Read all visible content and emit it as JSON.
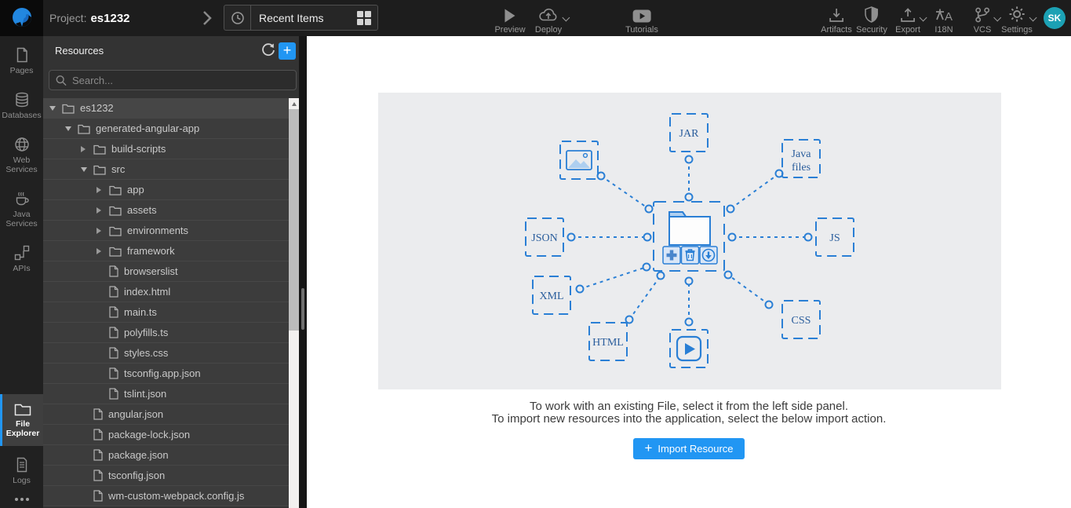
{
  "topbar": {
    "project_label": "Project:",
    "project_name": "es1232",
    "recent": {
      "label": "Recent Items"
    },
    "center_actions": [
      {
        "label": "Preview",
        "icon": "play-icon",
        "caret": false
      },
      {
        "label": "Deploy",
        "icon": "cloud-upload-icon",
        "caret": true
      },
      {
        "label": "Tutorials",
        "icon": "video-tutorials-icon",
        "caret": false
      }
    ],
    "right_actions": [
      {
        "label": "Artifacts",
        "icon": "download-tray-icon",
        "caret": false
      },
      {
        "label": "Security",
        "icon": "shield-icon",
        "caret": false
      },
      {
        "label": "Export",
        "icon": "upload-tray-icon",
        "caret": true
      },
      {
        "label": "I18N",
        "icon": "translate-icon",
        "caret": false
      },
      {
        "label": "VCS",
        "icon": "git-branch-icon",
        "caret": true
      },
      {
        "label": "Settings",
        "icon": "gear-icon",
        "caret": true
      }
    ],
    "avatar_initials": "SK"
  },
  "sidebar": {
    "items": [
      {
        "label": "Pages",
        "icon": "page-icon"
      },
      {
        "label": "Databases",
        "icon": "database-icon"
      },
      {
        "label": "Web Services",
        "icon": "globe-icon"
      },
      {
        "label": "Java Services",
        "icon": "coffee-cup-icon"
      },
      {
        "label": "APIs",
        "icon": "api-nodes-icon"
      },
      {
        "label": "File Explorer",
        "icon": "folder-icon",
        "active": true
      },
      {
        "label": "Logs",
        "icon": "log-file-icon"
      }
    ]
  },
  "resources": {
    "title": "Resources",
    "search_placeholder": "Search...",
    "tree": [
      {
        "name": "es1232",
        "type": "folder",
        "level": 0,
        "state": "expanded"
      },
      {
        "name": "generated-angular-app",
        "type": "folder",
        "level": 1,
        "state": "expanded"
      },
      {
        "name": "build-scripts",
        "type": "folder",
        "level": 2,
        "state": "collapsed"
      },
      {
        "name": "src",
        "type": "folder",
        "level": 2,
        "state": "expanded"
      },
      {
        "name": "app",
        "type": "folder",
        "level": 3,
        "state": "collapsed"
      },
      {
        "name": "assets",
        "type": "folder",
        "level": 3,
        "state": "collapsed"
      },
      {
        "name": "environments",
        "type": "folder",
        "level": 3,
        "state": "collapsed"
      },
      {
        "name": "framework",
        "type": "folder",
        "level": 3,
        "state": "collapsed"
      },
      {
        "name": "browserslist",
        "type": "file",
        "level": 3
      },
      {
        "name": "index.html",
        "type": "file",
        "level": 3
      },
      {
        "name": "main.ts",
        "type": "file",
        "level": 3
      },
      {
        "name": "polyfills.ts",
        "type": "file",
        "level": 3
      },
      {
        "name": "styles.css",
        "type": "file",
        "level": 3
      },
      {
        "name": "tsconfig.app.json",
        "type": "file",
        "level": 3
      },
      {
        "name": "tslint.json",
        "type": "file",
        "level": 3
      },
      {
        "name": "angular.json",
        "type": "file",
        "level": 2
      },
      {
        "name": "package-lock.json",
        "type": "file",
        "level": 2
      },
      {
        "name": "package.json",
        "type": "file",
        "level": 2
      },
      {
        "name": "tsconfig.json",
        "type": "file",
        "level": 2
      },
      {
        "name": "wm-custom-webpack.config.js",
        "type": "file",
        "level": 2
      }
    ]
  },
  "main": {
    "diagram": {
      "satellites": [
        {
          "label": "JAR"
        },
        {
          "label": "Java files",
          "line1": "Java",
          "line2": "files"
        },
        {
          "label": "JSON"
        },
        {
          "label": "JS"
        },
        {
          "label": "XML"
        },
        {
          "label": "HTML"
        },
        {
          "label": "CSS"
        }
      ],
      "icon_boxes": [
        "image-icon",
        "video-play-icon"
      ],
      "hub_buttons": [
        "add-icon",
        "trash-icon",
        "download-circle-icon"
      ]
    },
    "instruction_line1": "To work with an existing File, select it from the left side panel.",
    "instruction_line2": "To import new resources into the application, select the below import action.",
    "import_button_label": "Import Resource"
  },
  "colors": {
    "accent": "#2196f3",
    "diagram_blue": "#2a7fd5",
    "diagram_text": "#2a5d9c",
    "avatar_bg": "#1ca1b4",
    "topbar_bg": "#1d1d1d",
    "panel_bg": "#333333",
    "diagram_panel_bg": "#ebecee"
  }
}
